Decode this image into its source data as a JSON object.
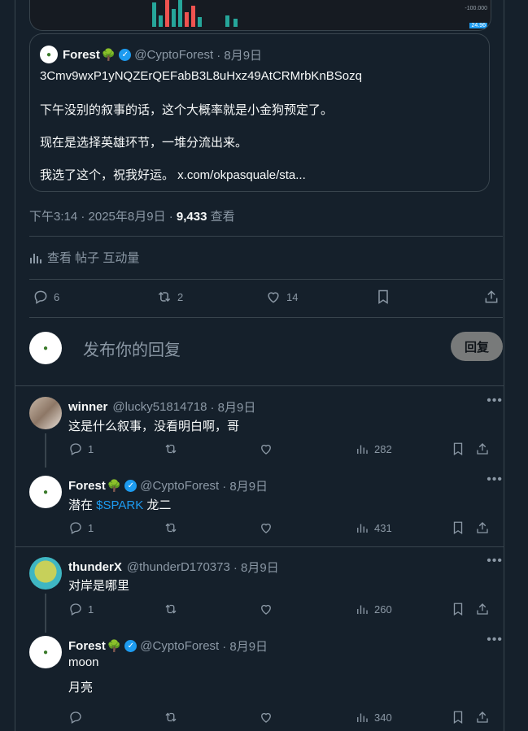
{
  "chart_strip": {
    "axis_label": "-100.000",
    "price_label": "24.96"
  },
  "quote": {
    "author_name": "Forest",
    "author_handle": "@CyptoForest",
    "date": "· 8月9日",
    "line1": "3Cmv9wxP1yNQZErQEFabB3L8uHxz49AtCRMrbKnBSozq",
    "line2": "下午没别的叙事的话，这个大概率就是小金狗预定了。",
    "line3": "现在是选择英雄环节，一堆分流出来。",
    "line4": "我选了这个，祝我好运。 x.com/okpasquale/sta..."
  },
  "meta": {
    "timestamp": "下午3:14 · 2025年8月9日 · ",
    "views_count": "9,433",
    "views_label": " 查看"
  },
  "analytics_label": "查看 帖子 互动量",
  "actions": {
    "replies": "6",
    "reposts": "2",
    "likes": "14"
  },
  "reply_box": {
    "placeholder": "发布你的回复",
    "button_label": "回复"
  },
  "comments": [
    {
      "name": "winner",
      "handle": "@lucky51814718",
      "date": "· 8月9日",
      "text": "这是什么叙事，没看明白啊，哥",
      "replies": "1",
      "reposts": "",
      "likes": "",
      "views": "282"
    },
    {
      "name": "Forest",
      "handle": "@CyptoForest",
      "date": "· 8月9日",
      "text_prefix": "潜在 ",
      "text_link": "$SPARK",
      "text_suffix": " 龙二",
      "replies": "1",
      "reposts": "",
      "likes": "",
      "views": "431"
    },
    {
      "name": "thunderX",
      "handle": "@thunderD170373",
      "date": "· 8月9日",
      "text": "对岸是哪里",
      "replies": "1",
      "reposts": "",
      "likes": "",
      "views": "260"
    },
    {
      "name": "Forest",
      "handle": "@CyptoForest",
      "date": "· 8月9日",
      "text": "moon",
      "text2": "月亮",
      "replies": "",
      "reposts": "",
      "likes": "",
      "views": "340"
    }
  ],
  "colors": {
    "accent": "#1d9bf0",
    "background": "#15202b",
    "border": "#38444d",
    "muted": "#8b98a5"
  }
}
